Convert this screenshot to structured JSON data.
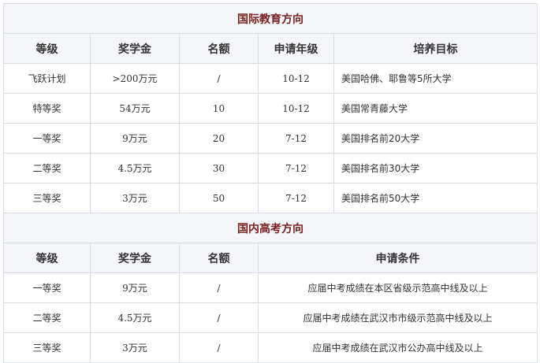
{
  "intl": {
    "title": "国际教育方向",
    "headers": [
      "等级",
      "奖学金",
      "名额",
      "申请年级",
      "培养目标"
    ],
    "rows": [
      [
        "飞跃计划",
        ">200万元",
        "/",
        "10-12",
        "美国哈佛、耶鲁等5所大学"
      ],
      [
        "特等奖",
        "54万元",
        "10",
        "10-12",
        "美国常青藤大学"
      ],
      [
        "一等奖",
        "9万元",
        "20",
        "7-12",
        "美国排名前20大学"
      ],
      [
        "二等奖",
        "4.5万元",
        "30",
        "7-12",
        "美国排名前30大学"
      ],
      [
        "三等奖",
        "3万元",
        "50",
        "7-12",
        "美国排名前50大学"
      ]
    ]
  },
  "domestic": {
    "title": "国内高考方向",
    "headers": [
      "等级",
      "奖学金",
      "名额",
      "申请条件"
    ],
    "rows": [
      [
        "一等奖",
        "9万元",
        "/",
        "应届中考成绩在本区省级示范高中线及以上"
      ],
      [
        "二等奖",
        "4.5万元",
        "/",
        "应届中考成绩在武汉市市级示范高中线及以上"
      ],
      [
        "三等奖",
        "3万元",
        "/",
        "应届中考成绩在武汉市公办高中线及以上"
      ]
    ]
  },
  "colors": {
    "section_title": "#7a1f1f",
    "header_bg": "#f4f6fa",
    "border": "#d8dde6"
  }
}
